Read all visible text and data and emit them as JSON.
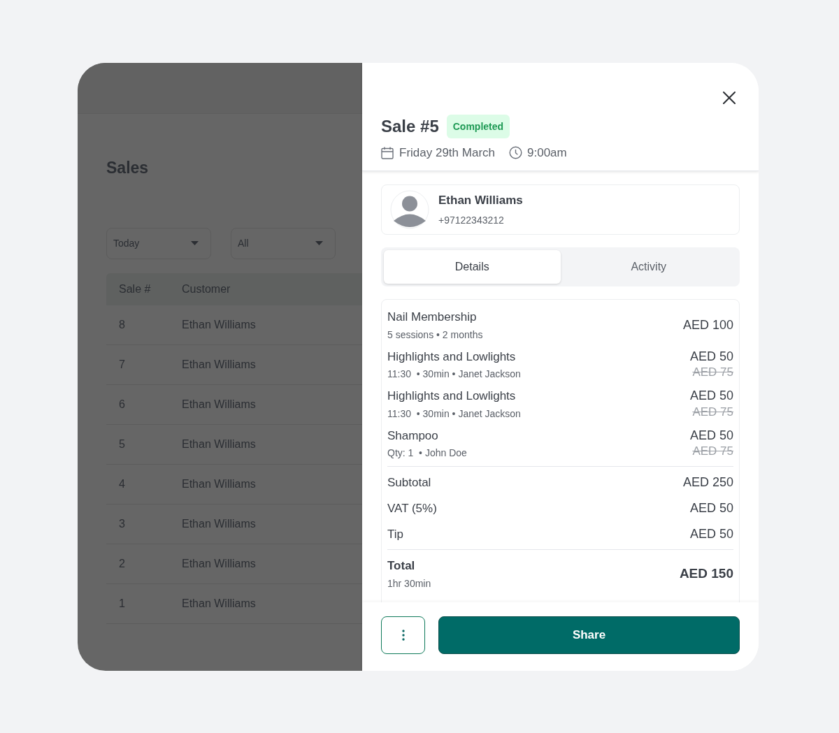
{
  "page": {
    "title": "Sales",
    "filters": [
      {
        "label": "Today"
      },
      {
        "label": "All"
      }
    ],
    "table": {
      "columns": [
        "Sale #",
        "Customer"
      ],
      "rows": [
        [
          "8",
          "Ethan Williams"
        ],
        [
          "7",
          "Ethan Williams"
        ],
        [
          "6",
          "Ethan Williams"
        ],
        [
          "5",
          "Ethan Williams"
        ],
        [
          "4",
          "Ethan Williams"
        ],
        [
          "3",
          "Ethan Williams"
        ],
        [
          "2",
          "Ethan Williams"
        ],
        [
          "1",
          "Ethan Williams"
        ]
      ]
    }
  },
  "sale_panel": {
    "title": "Sale #5",
    "status": "Completed",
    "date": "Friday 29th March",
    "time": "9:00am",
    "customer": {
      "name": "Ethan Williams",
      "phone": "+97122343212"
    },
    "tabs": [
      {
        "label": "Details",
        "selected": true
      },
      {
        "label": "Activity",
        "selected": false
      }
    ],
    "items": [
      {
        "name": "Nail Membership",
        "detail": "5 sessions • 2 months",
        "price": "AED 100"
      },
      {
        "name": "Highlights and Lowlights",
        "detail": "11:30  • 30min • Janet Jackson",
        "price": "AED 50",
        "original_price": "AED 75"
      },
      {
        "name": "Highlights and Lowlights",
        "detail": "11:30  • 30min • Janet Jackson",
        "price": "AED 50",
        "original_price": "AED 75"
      },
      {
        "name": "Shampoo",
        "detail": "Qty: 1  • John Doe",
        "price": "AED 50",
        "original_price": "AED 75"
      }
    ],
    "summary": [
      {
        "label": "Subtotal",
        "value": "AED 250"
      },
      {
        "label": "VAT (5%)",
        "value": "AED 50"
      },
      {
        "label": "Tip",
        "value": "AED 50"
      }
    ],
    "total": {
      "label": "Total",
      "duration": "1hr 30min",
      "value": "AED 150"
    },
    "share_button": "Share"
  }
}
